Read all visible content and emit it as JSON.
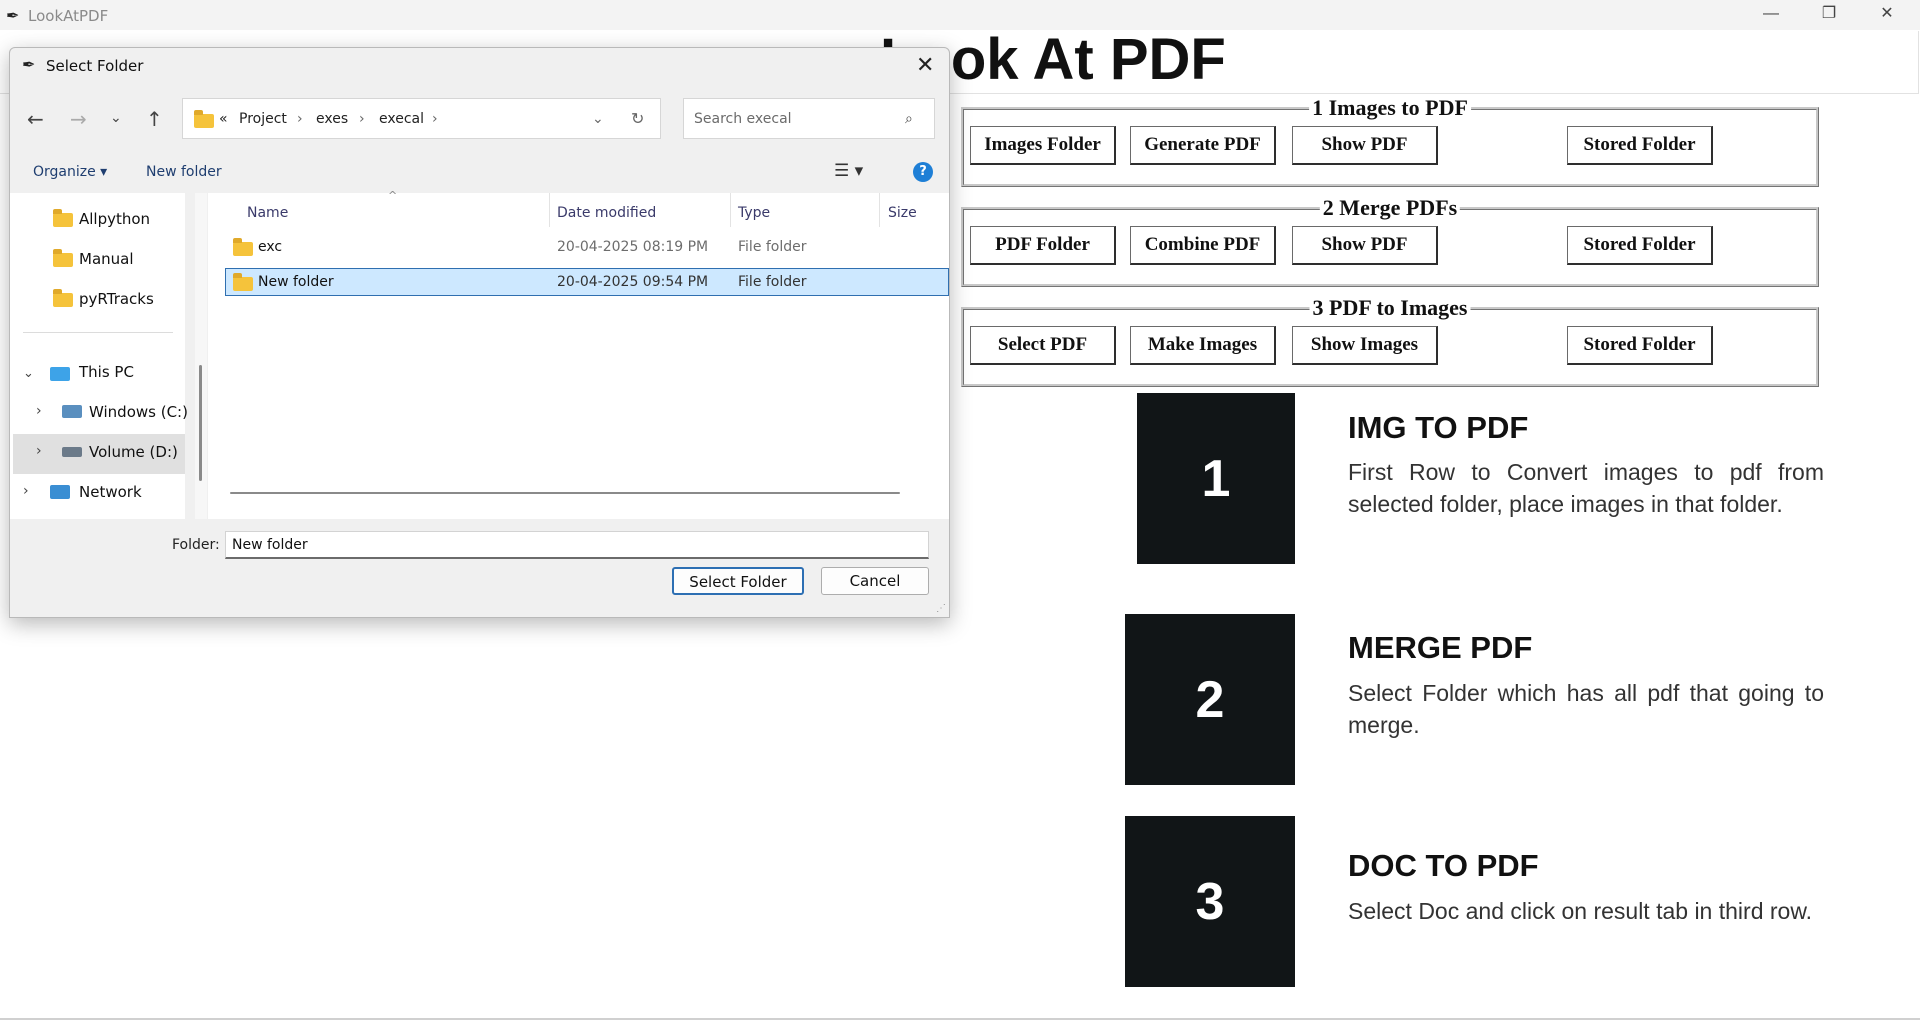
{
  "app": {
    "title": "LookAtPDF",
    "heading": "Look At PDF"
  },
  "frames": [
    {
      "title": "1 Images to PDF",
      "buttons": [
        "Images Folder",
        "Generate PDF",
        "Show PDF",
        "Stored Folder"
      ]
    },
    {
      "title": "2 Merge PDFs",
      "buttons": [
        "PDF Folder",
        "Combine PDF",
        "Show PDF",
        "Stored Folder"
      ]
    },
    {
      "title": "3 PDF to Images",
      "buttons": [
        "Select PDF",
        "Make Images",
        "Show Images",
        "Stored Folder"
      ]
    }
  ],
  "info": [
    {
      "number": "1",
      "title": "IMG TO PDF",
      "desc": "First Row to Convert images to pdf from selected folder, place images in that folder."
    },
    {
      "number": "2",
      "title": "MERGE PDF",
      "desc": "Select Folder which has all pdf that going to merge."
    },
    {
      "number": "3",
      "title": "DOC TO PDF",
      "desc": "Select Doc and click on result tab in third row."
    }
  ],
  "dialog": {
    "title": "Select Folder",
    "breadcrumb": [
      "«",
      "Project",
      "exes",
      "execal"
    ],
    "search_placeholder": "Search execal",
    "toolbar": {
      "organize": "Organize ▾",
      "new_folder": "New folder"
    },
    "nav_items": [
      "Allpython",
      "Manual",
      "pyRTracks",
      "This PC",
      "Windows (C:)",
      "Volume (D:)",
      "Network"
    ],
    "columns": [
      "Name",
      "Date modified",
      "Type",
      "Size"
    ],
    "files": [
      {
        "name": "exc",
        "date": "20-04-2025 08:19 PM",
        "type": "File folder"
      },
      {
        "name": "New folder",
        "date": "20-04-2025 09:54 PM",
        "type": "File folder"
      }
    ],
    "folder_label": "Folder:",
    "folder_value": "New folder",
    "select_button": "Select Folder",
    "cancel_button": "Cancel"
  }
}
